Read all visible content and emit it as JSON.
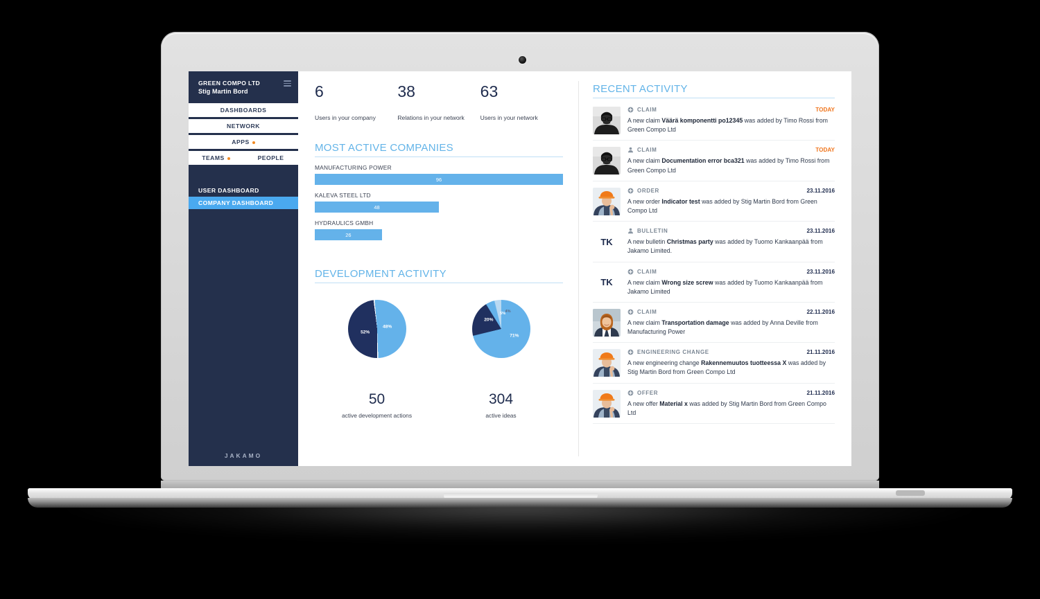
{
  "device": {
    "type": "laptop-mockup",
    "brand_visible": false
  },
  "sidebar": {
    "company": "GREEN COMPO LTD",
    "user": "Stig Martin Bord",
    "menu_icon": "hamburger-icon",
    "nav": [
      {
        "label": "DASHBOARDS",
        "badge": false
      },
      {
        "label": "NETWORK",
        "badge": false
      },
      {
        "label": "APPS",
        "badge": true
      }
    ],
    "sub_nav": [
      {
        "label": "TEAMS",
        "badge": true
      },
      {
        "label": "PEOPLE",
        "badge": false
      }
    ],
    "links": [
      {
        "label": "USER DASHBOARD",
        "active": false
      },
      {
        "label": "COMPANY DASHBOARD",
        "active": true
      }
    ],
    "logo": "JAKAMO",
    "badge_color": "#f08a24",
    "bg_color": "#24304c",
    "active_color": "#4aa9ef"
  },
  "stats": [
    {
      "value": "6",
      "label": "Users in your company"
    },
    {
      "value": "38",
      "label": "Relations in your network"
    },
    {
      "value": "63",
      "label": "Users in your network"
    }
  ],
  "most_active_companies": {
    "title": "MOST ACTIVE COMPANIES",
    "items": [
      {
        "name": "MANUFACTURING POWER",
        "value": "96"
      },
      {
        "name": "KALEVA STEEL LTD",
        "value": "48"
      },
      {
        "name": "HYDRAULICS GMBH",
        "value": "26"
      }
    ]
  },
  "development_activity": {
    "title": "DEVELOPMENT ACTIVITY",
    "charts": [
      {
        "number": "50",
        "caption": "active development actions"
      },
      {
        "number": "304",
        "caption": "active ideas"
      }
    ]
  },
  "chart_data": [
    {
      "type": "bar",
      "title": "MOST ACTIVE COMPANIES",
      "orientation": "horizontal",
      "categories": [
        "MANUFACTURING POWER",
        "KALEVA STEEL LTD",
        "HYDRAULICS GMBH"
      ],
      "values": [
        96,
        48,
        26
      ],
      "xlabel": "",
      "ylabel": "",
      "xlim": [
        0,
        96
      ],
      "grid": false,
      "legend": "none",
      "bar_color": "#64b2ea",
      "data_labels": [
        "96",
        "48",
        "26"
      ]
    },
    {
      "type": "pie",
      "title": "active development actions",
      "total": 50,
      "labels": [
        "52%",
        "48%"
      ],
      "values": [
        52,
        48
      ],
      "colors": [
        "#64b2ea",
        "#20305f"
      ],
      "legend": "none"
    },
    {
      "type": "pie",
      "title": "active ideas",
      "total": 304,
      "labels": [
        "71%",
        "20%",
        "5%",
        "4%"
      ],
      "values": [
        71,
        20,
        5,
        4
      ],
      "colors": [
        "#64b2ea",
        "#20305f",
        "#64b2ea",
        "#b9d9f2"
      ],
      "legend": "none"
    }
  ],
  "recent_activity": {
    "title": "RECENT ACTIVITY",
    "items": [
      {
        "avatar_kind": "photo-man-glasses",
        "avatar_text": "",
        "icon": "plus-circle-icon",
        "type": "CLAIM",
        "date": "TODAY",
        "today": true,
        "pre": "A new claim ",
        "subject": "Väärä komponentti po12345",
        "post": " was added by Timo Rossi from Green Compo Ltd"
      },
      {
        "avatar_kind": "photo-man-glasses",
        "avatar_text": "",
        "icon": "person-icon",
        "type": "CLAIM",
        "date": "TODAY",
        "today": true,
        "pre": "A new claim ",
        "subject": "Documentation error bca321",
        "post": " was added by Timo Rossi from Green Compo Ltd"
      },
      {
        "avatar_kind": "photo-worker-helmet",
        "avatar_text": "",
        "icon": "plus-circle-icon",
        "type": "ORDER",
        "date": "23.11.2016",
        "today": false,
        "pre": "A new order ",
        "subject": "Indicator test",
        "post": " was added by Stig Martin Bord from Green Compo Ltd"
      },
      {
        "avatar_kind": "initials",
        "avatar_text": "TK",
        "icon": "person-icon",
        "type": "BULLETIN",
        "date": "23.11.2016",
        "today": false,
        "pre": "A new bulletin ",
        "subject": "Christmas party",
        "post": " was added by Tuomo Kankaanpää from Jakamo Limited."
      },
      {
        "avatar_kind": "initials",
        "avatar_text": "TK",
        "icon": "plus-circle-icon",
        "type": "CLAIM",
        "date": "23.11.2016",
        "today": false,
        "pre": "A new claim ",
        "subject": "Wrong size screw",
        "post": " was added by Tuomo Kankaanpää from Jakamo Limited"
      },
      {
        "avatar_kind": "photo-woman",
        "avatar_text": "",
        "icon": "plus-circle-icon",
        "type": "CLAIM",
        "date": "22.11.2016",
        "today": false,
        "pre": "A new claim ",
        "subject": "Transportation damage",
        "post": " was added by Anna Deville from Manufacturing Power"
      },
      {
        "avatar_kind": "photo-worker-helmet",
        "avatar_text": "",
        "icon": "plus-circle-icon",
        "type": "ENGINEERING CHANGE",
        "date": "21.11.2016",
        "today": false,
        "pre": "A new engineering change ",
        "subject": "Rakennemuutos tuotteessa X",
        "post": " was added by Stig Martin Bord from Green Compo Ltd"
      },
      {
        "avatar_kind": "photo-worker-helmet",
        "avatar_text": "",
        "icon": "plus-circle-icon",
        "type": "OFFER",
        "date": "21.11.2016",
        "today": false,
        "pre": "A new offer ",
        "subject": "Material x",
        "post": " was added by Stig Martin Bord from Green Compo Ltd"
      }
    ]
  }
}
